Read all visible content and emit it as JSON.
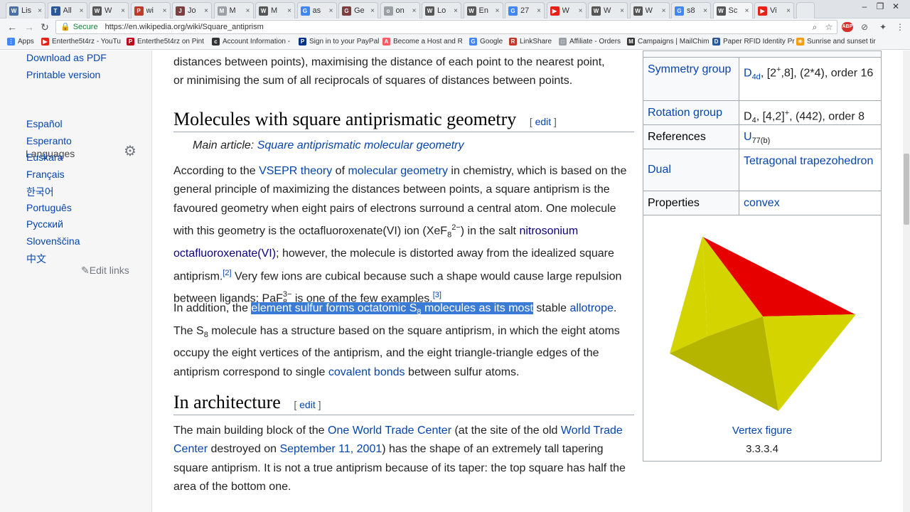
{
  "browser": {
    "tabs": [
      {
        "label": "Lis",
        "color": "#4a6fa5",
        "glyph": "W"
      },
      {
        "label": "All",
        "color": "#2b5797",
        "glyph": "T"
      },
      {
        "label": "W",
        "color": "#555555",
        "glyph": "W"
      },
      {
        "label": "wi",
        "color": "#c0392b",
        "glyph": "P"
      },
      {
        "label": "Jo",
        "color": "#7b3f3f",
        "glyph": "J"
      },
      {
        "label": "M",
        "color": "#9aa0a6",
        "glyph": "M"
      },
      {
        "label": "M",
        "color": "#555555",
        "glyph": "W"
      },
      {
        "label": "as",
        "color": "#4285f4",
        "glyph": "G"
      },
      {
        "label": "Ge",
        "color": "#7b3f3f",
        "glyph": "G"
      },
      {
        "label": "on",
        "color": "#9aa0a6",
        "glyph": "o"
      },
      {
        "label": "Lo",
        "color": "#555555",
        "glyph": "W"
      },
      {
        "label": "En",
        "color": "#555555",
        "glyph": "W"
      },
      {
        "label": "27",
        "color": "#4285f4",
        "glyph": "G"
      },
      {
        "label": "W",
        "color": "#e62117",
        "glyph": "▶"
      },
      {
        "label": "W",
        "color": "#555555",
        "glyph": "W"
      },
      {
        "label": "W",
        "color": "#555555",
        "glyph": "W"
      },
      {
        "label": "s8",
        "color": "#4285f4",
        "glyph": "G"
      },
      {
        "label": "Sc",
        "color": "#555555",
        "glyph": "W"
      },
      {
        "label": "Vi",
        "color": "#e62117",
        "glyph": "▶"
      }
    ],
    "active_tab_index": 17,
    "url_security": "Secure",
    "url": "https://en.wikipedia.org/wiki/Square_antiprism",
    "bookmarks": [
      {
        "label": "Apps",
        "color": "#4285f4",
        "glyph": "⋮"
      },
      {
        "label": "Enterthe5t4rz - YouTu",
        "color": "#e62117",
        "glyph": "▶"
      },
      {
        "label": "Enterthe5t4rz on Pint",
        "color": "#bd081c",
        "glyph": "P"
      },
      {
        "label": "Account Information -",
        "color": "#333333",
        "glyph": "c"
      },
      {
        "label": "Sign in to your PayPal",
        "color": "#003087",
        "glyph": "P"
      },
      {
        "label": "Become a Host and R",
        "color": "#ff5a5f",
        "glyph": "A"
      },
      {
        "label": "Google",
        "color": "#4285f4",
        "glyph": "G"
      },
      {
        "label": "LinkShare",
        "color": "#c0392b",
        "glyph": "R"
      },
      {
        "label": "Affiliate - Orders",
        "color": "#9aa0a6",
        "glyph": "□"
      },
      {
        "label": "Campaigns | MailChim",
        "color": "#333333",
        "glyph": "M"
      },
      {
        "label": "Paper RFID Identity Pr",
        "color": "#2b5797",
        "glyph": "D"
      },
      {
        "label": "Sunrise and sunset tir",
        "color": "#f39c12",
        "glyph": "✳"
      }
    ]
  },
  "sidebar": {
    "download_pdf": "Download as PDF",
    "printable_version": "Printable version",
    "languages_heading": "Languages",
    "languages": [
      "Español",
      "Esperanto",
      "Euskara",
      "Français",
      "한국어",
      "Português",
      "Русский",
      "Slovenščina",
      "中文"
    ],
    "edit_links": "Edit links"
  },
  "article": {
    "intro_line1": "distances between points), maximising the distance of each point to the nearest point,",
    "intro_line2": "or minimising the sum of all reciprocals of squares of distances between points.",
    "h2_molecules": "Molecules with square antiprismatic geometry",
    "edit_label": "edit",
    "main_article_label": "Main article: ",
    "main_article_link": "Square antiprismatic molecular geometry",
    "p1": {
      "t1": "According to the ",
      "vsepr": "VSEPR theory",
      "t2": " of ",
      "molgeo": "molecular geometry",
      "t3": " in chemistry, which is based on the general principle of maximizing the distances between points, a square antiprism is the favoured geometry when eight pairs of electrons surround a central atom. One molecule with this geometry is the octafluoroxenate(VI) ion (XeF",
      "sub8a": "8",
      "sup2m": "2−",
      "t4": ") in the salt ",
      "nitro": "nitrosonium octafluoroxenate(VI)",
      "t5": "; however, the molecule is distorted away from the idealized square antiprism.",
      "ref2": "[2]",
      "t6": " Very few ions are cubical because such a shape would cause large repulsion between ligands; PaF",
      "sub8b": "8",
      "sup3m": "3−",
      "t7": " is one of the few examples.",
      "ref3": "[3]"
    },
    "p2": {
      "t1": "In addition, the ",
      "hl1": "element sulfur forms octatomic S",
      "hlsub": "8",
      "hl2": " molecules as its most",
      "t2": " stable ",
      "allotrope": "allotrope",
      "t3": ". The S",
      "sub8": "8",
      "t4": " molecule has a structure based on the square antiprism, in which the eight atoms occupy the eight vertices of the antiprism, and the eight triangle-triangle edges of the antiprism correspond to single ",
      "covalent": "covalent bonds",
      "t5": " between sulfur atoms."
    },
    "h2_architecture": "In architecture",
    "p3": {
      "t1": "The main building block of the ",
      "owtc": "One World Trade Center",
      "t2": " (at the site of the old ",
      "wtc": "World Trade Center",
      "t3": " destroyed on ",
      "sept": "September 11, 2001",
      "t4": ") has the shape of an extremely tall tapering square antiprism. It is not a true antiprism because of its taper: the top square has half the area of the bottom one."
    }
  },
  "infobox": {
    "symmetry_label": "Symmetry group",
    "symmetry_d": "D",
    "symmetry_sub": "4d",
    "symmetry_rest1": ", [2",
    "symmetry_sup": "+",
    "symmetry_rest2": ",8], (2*4), order 16",
    "rotation_label": "Rotation group",
    "rotation_d": "D",
    "rotation_sub": "4",
    "rotation_rest1": ", [4,2]",
    "rotation_sup": "+",
    "rotation_rest2": ", (442), order 8",
    "references_label": "References",
    "references_u": "U",
    "references_sub": "77(b)",
    "dual_label": "Dual",
    "dual_value": "Tetragonal trapezohedron",
    "properties_label": "Properties",
    "properties_value": "convex",
    "vertex_caption": "Vertex figure",
    "vertex_notation": "3.3.3.4",
    "colors": {
      "red": "#e60000",
      "yellow": "#d4d400",
      "dark_yellow": "#8a8a00",
      "mid_yellow": "#b5b500"
    }
  }
}
